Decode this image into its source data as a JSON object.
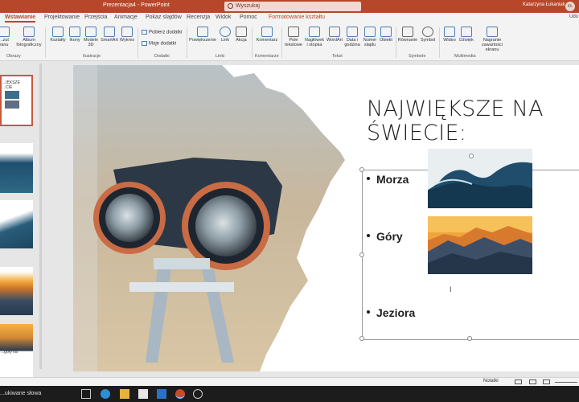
{
  "window": {
    "title": "Prezentacja4 - PowerPoint",
    "search_placeholder": "Wyszukaj",
    "user_name": "Katarzyna Łukaniak",
    "user_initials": "KŁ"
  },
  "ribbon_tabs": [
    {
      "label": "Wstawianie",
      "active": true
    },
    {
      "label": "Projektowanie"
    },
    {
      "label": "Przejścia"
    },
    {
      "label": "Animacje"
    },
    {
      "label": "Pokaz slajdów"
    },
    {
      "label": "Recenzja"
    },
    {
      "label": "Widok"
    },
    {
      "label": "Pomoc"
    },
    {
      "label": "Formatowanie kształtu",
      "contextual": true
    }
  ],
  "ribbon": {
    "buttons": {
      "screenshot": "...zut\nranu",
      "album": "Album\nfotograficzny",
      "shapes": "Kształty",
      "icons": "Ikony",
      "models": "Modele\n3D",
      "smartart": "SmartArt",
      "chart": "Wykres",
      "zoom": "Powiększenie",
      "link": "Link",
      "action": "Akcja",
      "comment": "Komentarz",
      "textbox": "Pole\ntekstowe",
      "header": "Nagłówek\ni stopka",
      "wordart": "WordArt",
      "datetime": "Data i\ngodzina",
      "slidenum": "Numer\nslajdu",
      "object": "Obiekt",
      "equation": "Równanie",
      "symbol": "Symbol",
      "video": "Wideo",
      "audio": "Dźwięk",
      "record": "Nagranie\nzawartości ekranu"
    },
    "addins_get": "Pobierz dodatki",
    "addins_mine": "Moje dodatki",
    "groups": {
      "images": "Obrazy",
      "illustrations": "Ilustracje",
      "addins": "Dodatki",
      "links": "Linki",
      "comments": "Komentarze",
      "text": "Tekst",
      "symbols": "Symbole",
      "media": "Multimedia"
    },
    "share": "Udo"
  },
  "thumbnails": {
    "slide1_caption_1": "...IĘKSZE",
    "slide1_caption_2": "...CIE",
    "slide5_caption": "...góry na"
  },
  "slide": {
    "title": "NAJWIĘKSZE NA ŚWIECIE:",
    "bullets": [
      "Morza",
      "Góry",
      "Jeziora"
    ]
  },
  "statusbar": {
    "notes": "Notatki"
  },
  "taskbar": {
    "search": "...ukiwane słowa"
  }
}
